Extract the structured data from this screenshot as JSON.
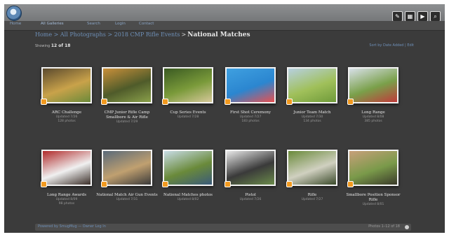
{
  "nav": {
    "items": [
      "Home",
      "All Galleries",
      "Search",
      "Login",
      "Contact"
    ]
  },
  "breadcrumb": {
    "parent": "Home > All Photographs > 2018 CMP Rifle Events",
    "current": "National Matches"
  },
  "summary": {
    "showing_label": "Showing",
    "showing_value": "12 of 18"
  },
  "sort_link": "Sort by Date Added | Edit",
  "albums": [
    {
      "title": "ARC Challenge",
      "meta1": "Updated 7/26",
      "meta2": "128 photos",
      "colors": [
        "#5b4a2e",
        "#c9a24a",
        "#6b8a3a"
      ]
    },
    {
      "title": "CMP Junior Rifle Camp Smallbore & Air Rifle",
      "meta1": "Updated 7/29",
      "meta2": "",
      "colors": [
        "#c98f3a",
        "#4f5b2a",
        "#8aa04a"
      ]
    },
    {
      "title": "Cup Series Events",
      "meta1": "Updated 7/28",
      "meta2": "",
      "colors": [
        "#3a5a22",
        "#7a9a3a",
        "#d6c89a"
      ]
    },
    {
      "title": "First Shot Ceremony",
      "meta1": "Updated 7/27",
      "meta2": "183 photos",
      "colors": [
        "#3fa0e0",
        "#2b86d0",
        "#e85050"
      ]
    },
    {
      "title": "Junior Team Match",
      "meta1": "Updated 7/30",
      "meta2": "134 photos",
      "colors": [
        "#b7d0e0",
        "#a0c05a",
        "#6f9a3a"
      ]
    },
    {
      "title": "Long Range",
      "meta1": "Updated 8/08",
      "meta2": "385 photos",
      "colors": [
        "#d8e0e8",
        "#7aa04a",
        "#c03a3a"
      ]
    },
    {
      "title": "Long Range Awards",
      "meta1": "Updated 8/09",
      "meta2": "98 photos",
      "colors": [
        "#b02a2a",
        "#f0f0f0",
        "#3a2e28"
      ]
    },
    {
      "title": "National Match Air Gun Events",
      "meta1": "Updated 7/31",
      "meta2": "",
      "colors": [
        "#5a6a7a",
        "#c0a070",
        "#3a3a3a"
      ]
    },
    {
      "title": "National Matches photos",
      "meta1": "Updated 8/02",
      "meta2": "",
      "colors": [
        "#c8dce6",
        "#6a8a3a",
        "#3a5a7a"
      ]
    },
    {
      "title": "Pistol",
      "meta1": "Updated 7/26",
      "meta2": "",
      "colors": [
        "#e8e8e8",
        "#3a3a3a",
        "#6a8a4a"
      ]
    },
    {
      "title": "Rifle",
      "meta1": "Updated 7/27",
      "meta2": "",
      "colors": [
        "#6a8a3a",
        "#d0d0c0",
        "#3a4a2a"
      ]
    },
    {
      "title": "Smallbore Position Sponsor Rifle",
      "meta1": "Updated 8/01",
      "meta2": "",
      "colors": [
        "#c8a07a",
        "#7a9a4a",
        "#3a3a2a"
      ]
    }
  ],
  "footer": {
    "left": "Powered by SmugMug — Owner Log In",
    "right": "Photos 1–12 of 18"
  },
  "colors": {
    "background": "#3b3b3b",
    "link": "#6e8fb7",
    "badge": "#f29a20"
  }
}
